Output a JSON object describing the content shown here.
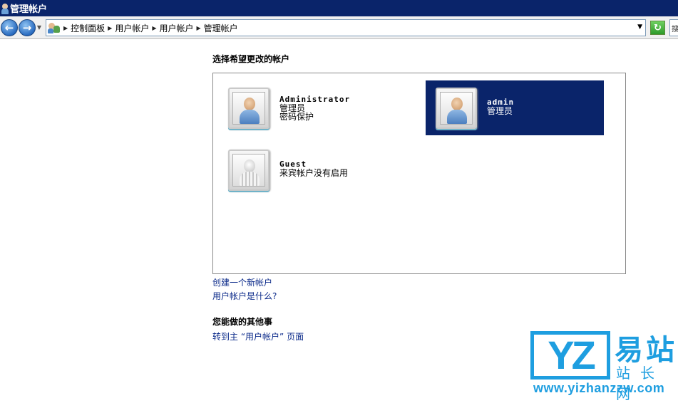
{
  "window": {
    "title": "管理帐户"
  },
  "address_bar": {
    "breadcrumbs": [
      "控制面板",
      "用户帐户",
      "用户帐户",
      "管理帐户"
    ],
    "back_icon": "back-arrow-icon",
    "forward_icon": "forward-arrow-icon",
    "refresh_icon": "refresh-icon",
    "search_stub": "搜"
  },
  "main": {
    "heading": "选择希望更改的帐户",
    "accounts": [
      {
        "name": "Administrator",
        "line1": "管理员",
        "line2": "密码保护",
        "selected": false
      },
      {
        "name": "admin",
        "line1": "管理员",
        "line2": "",
        "selected": true
      },
      {
        "name": "Guest",
        "line1": "来宾帐户没有启用",
        "line2": "",
        "selected": false
      }
    ],
    "links": {
      "create_account": "创建一个新帐户",
      "what_is_account": "用户帐户是什么?"
    },
    "other_section": {
      "heading": "您能做的其他事",
      "link": "转到主 “用户帐户” 页面"
    }
  },
  "watermark": {
    "logo_letters": "YZ",
    "main_text": "易站",
    "sub_text": "站长网",
    "url": "www.yizhanzzw.com"
  },
  "colors": {
    "titlebar": "#0a246a",
    "selection": "#0a246a",
    "link": "#0b2a8a",
    "watermark": "#1e9ee0"
  }
}
